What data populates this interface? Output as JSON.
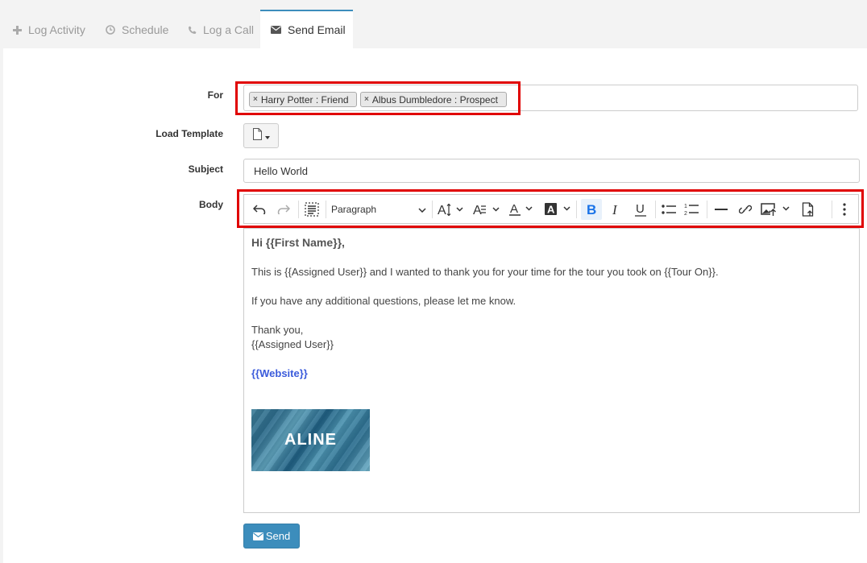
{
  "tabs": [
    {
      "label": "Log Activity",
      "icon": "plus-icon"
    },
    {
      "label": "Schedule",
      "icon": "clock-icon"
    },
    {
      "label": "Log a Call",
      "icon": "phone-icon"
    },
    {
      "label": "Send Email",
      "icon": "envelope-icon",
      "active": true
    }
  ],
  "form": {
    "for_label": "For",
    "recipients": [
      "Harry Potter : Friend",
      "Albus Dumbledore : Prospect"
    ],
    "template_label": "Load Template",
    "subject_label": "Subject",
    "subject_value": "Hello World",
    "body_label": "Body"
  },
  "toolbar": {
    "block_style": "Paragraph",
    "icons": [
      "undo-icon",
      "redo-icon",
      "select-all-icon",
      "font-size-icon",
      "font-family-icon",
      "font-color-icon",
      "background-color-icon",
      "bold-icon",
      "italic-icon",
      "underline-icon",
      "bulleted-list-icon",
      "numbered-list-icon",
      "horizontal-line-icon",
      "link-icon",
      "insert-image-icon",
      "insert-file-icon",
      "more-icon"
    ]
  },
  "body": {
    "greeting": "Hi {{First Name}},",
    "line1": "This is {{Assigned User}} and I wanted to thank you for your time for the tour you took on {{Tour On}}.",
    "line2": "If you have any additional questions, please let me know.",
    "signoff": "Thank you,",
    "signature": "{{Assigned User}}",
    "website": "{{Website}}",
    "logo_text": "ALINE"
  },
  "send_label": "Send",
  "colors": {
    "accent": "#3c8dbc",
    "highlight": "#e00000",
    "link": "#3b5bdb"
  }
}
